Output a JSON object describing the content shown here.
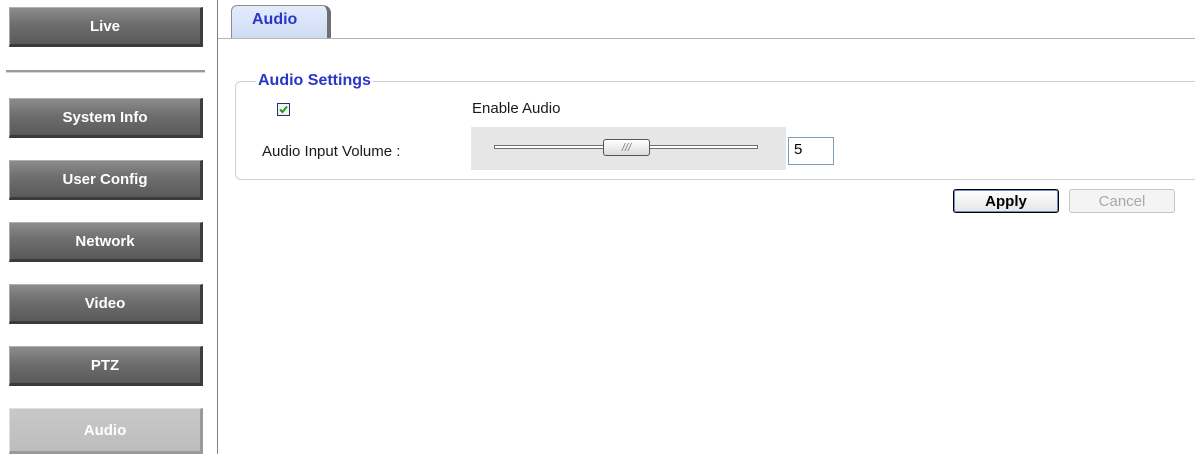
{
  "sidebar": {
    "items": [
      {
        "label": "Live",
        "active": false
      },
      {
        "label": "System Info",
        "active": false
      },
      {
        "label": "User Config",
        "active": false
      },
      {
        "label": "Network",
        "active": false
      },
      {
        "label": "Video",
        "active": false
      },
      {
        "label": "PTZ",
        "active": false
      },
      {
        "label": "Audio",
        "active": true
      }
    ]
  },
  "main": {
    "tab": {
      "label": "Audio"
    },
    "section": {
      "legend": "Audio Settings",
      "enable_audio": {
        "label": "Enable Audio",
        "checked": true
      },
      "volume": {
        "label": "Audio Input Volume :",
        "value": "5"
      }
    },
    "buttons": {
      "apply": "Apply",
      "cancel": "Cancel"
    }
  },
  "colors": {
    "accent": "#2a36c8",
    "nav_bg": "#6e6e6e",
    "nav_active_bg": "#c2c2c2"
  }
}
